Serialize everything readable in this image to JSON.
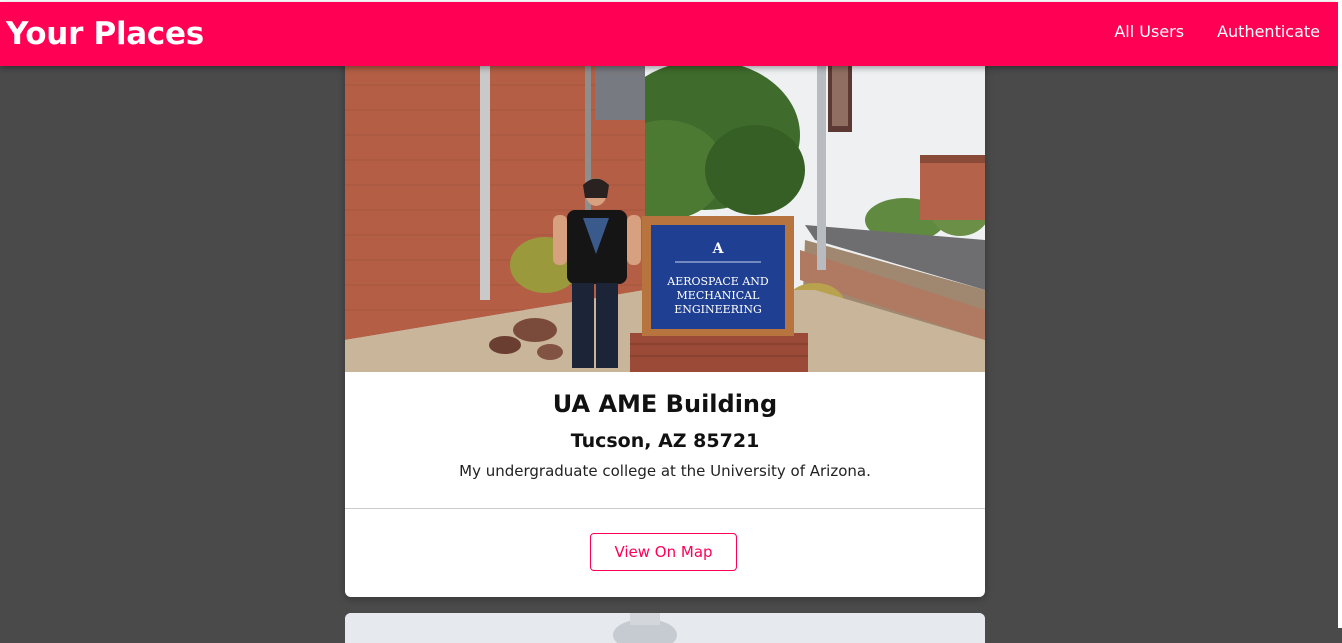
{
  "header": {
    "title": "Your Places",
    "nav": [
      {
        "label": "All Users"
      },
      {
        "label": "Authenticate"
      }
    ]
  },
  "place": {
    "sign_text": [
      "AEROSPACE AND",
      "MECHANICAL",
      "ENGINEERING"
    ],
    "title": "UA AME Building",
    "address": "Tucson, AZ 85721",
    "description": "My undergraduate college at the University of Arizona.",
    "view_button_label": "View On Map"
  },
  "colors": {
    "brand": "#ff0055",
    "background": "#4a4a4a"
  }
}
